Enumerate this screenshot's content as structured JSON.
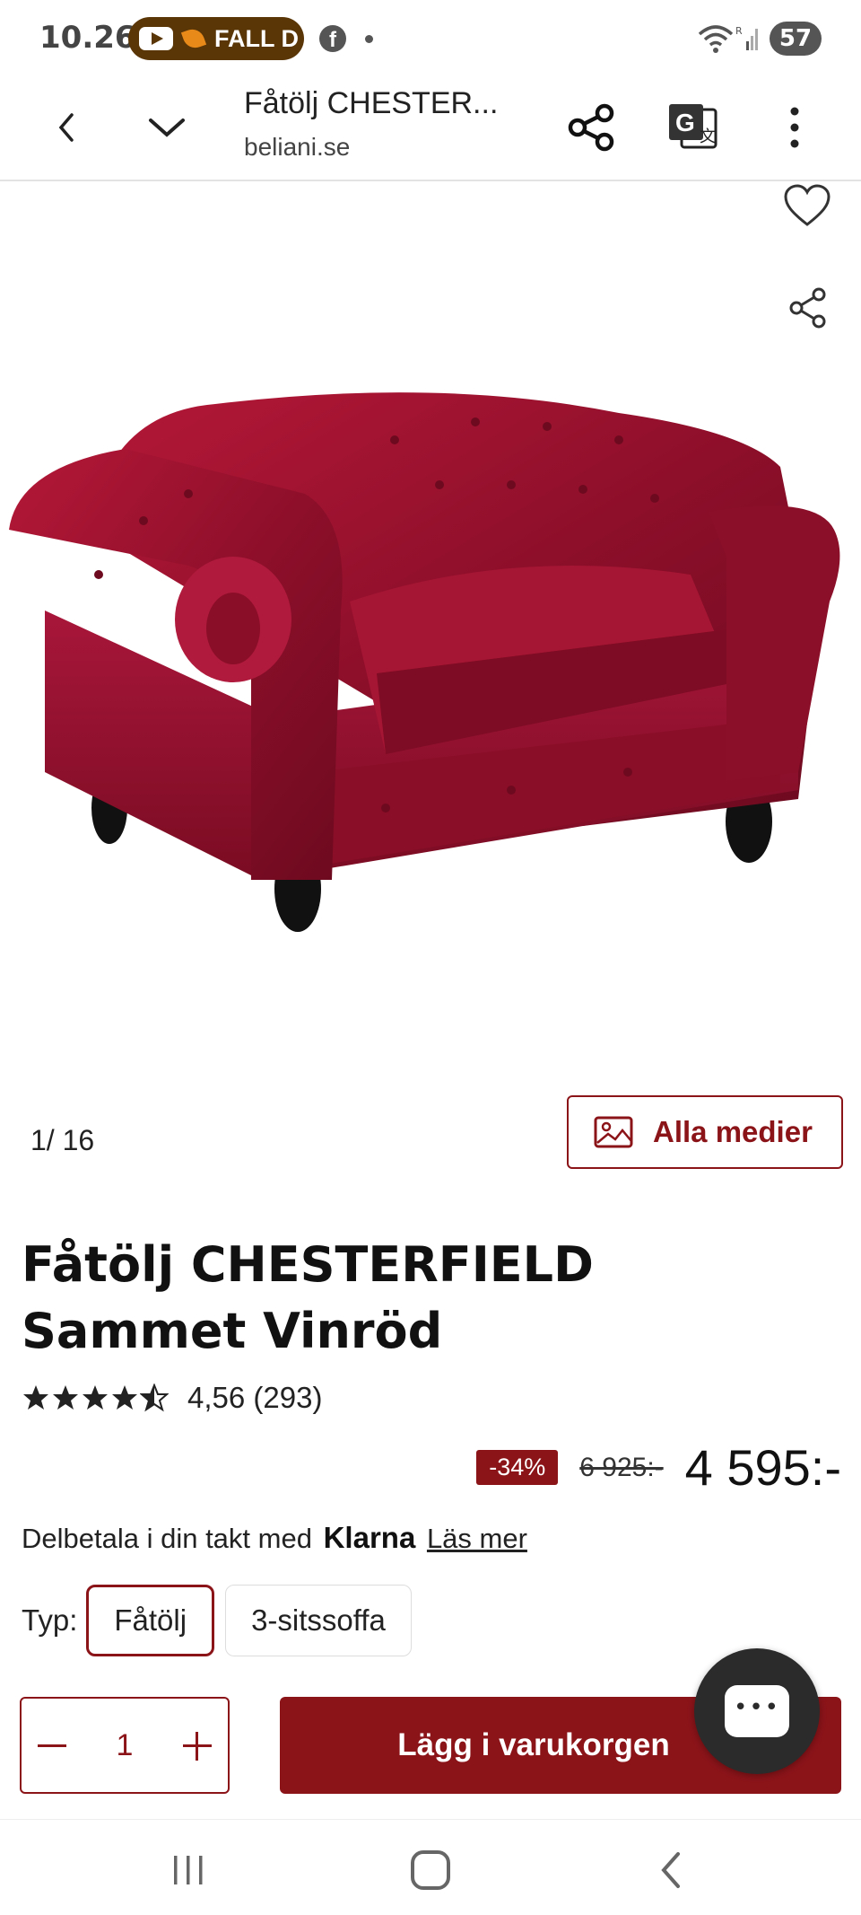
{
  "status_bar": {
    "time": "10.26",
    "notification_text": "FALL D",
    "battery": "57",
    "icons": [
      "youtube-icon",
      "facebook-icon",
      "wifi-icon",
      "signal-icon",
      "battery-icon"
    ]
  },
  "browser": {
    "tab_title": "Fåtölj CHESTER...",
    "domain": "beliani.se",
    "icons": [
      "back-icon",
      "chevron-down-icon",
      "share-icon",
      "translate-icon",
      "more-icon"
    ]
  },
  "gallery": {
    "counter": "1/  16",
    "all_media_label": "Alla medier"
  },
  "product": {
    "title": "Fåtölj CHESTERFIELD Sammet Vinröd",
    "rating_stars": 4.56,
    "rating_text": "4,56 (293)",
    "discount": "-34%",
    "old_price": "6 925:-",
    "new_price": "4 595:-",
    "installment_text": "Delbetala i din takt med",
    "klarna": "Klarna",
    "read_more": "Läs mer",
    "type_label": "Typ:",
    "types": [
      "Fåtölj",
      "3-sitssoffa"
    ],
    "selected_type": "Fåtölj",
    "quantity": "1",
    "add_to_cart": "Lägg i varukorgen"
  },
  "colors": {
    "brand": "#8b1419",
    "sofa": "#9c1430"
  }
}
